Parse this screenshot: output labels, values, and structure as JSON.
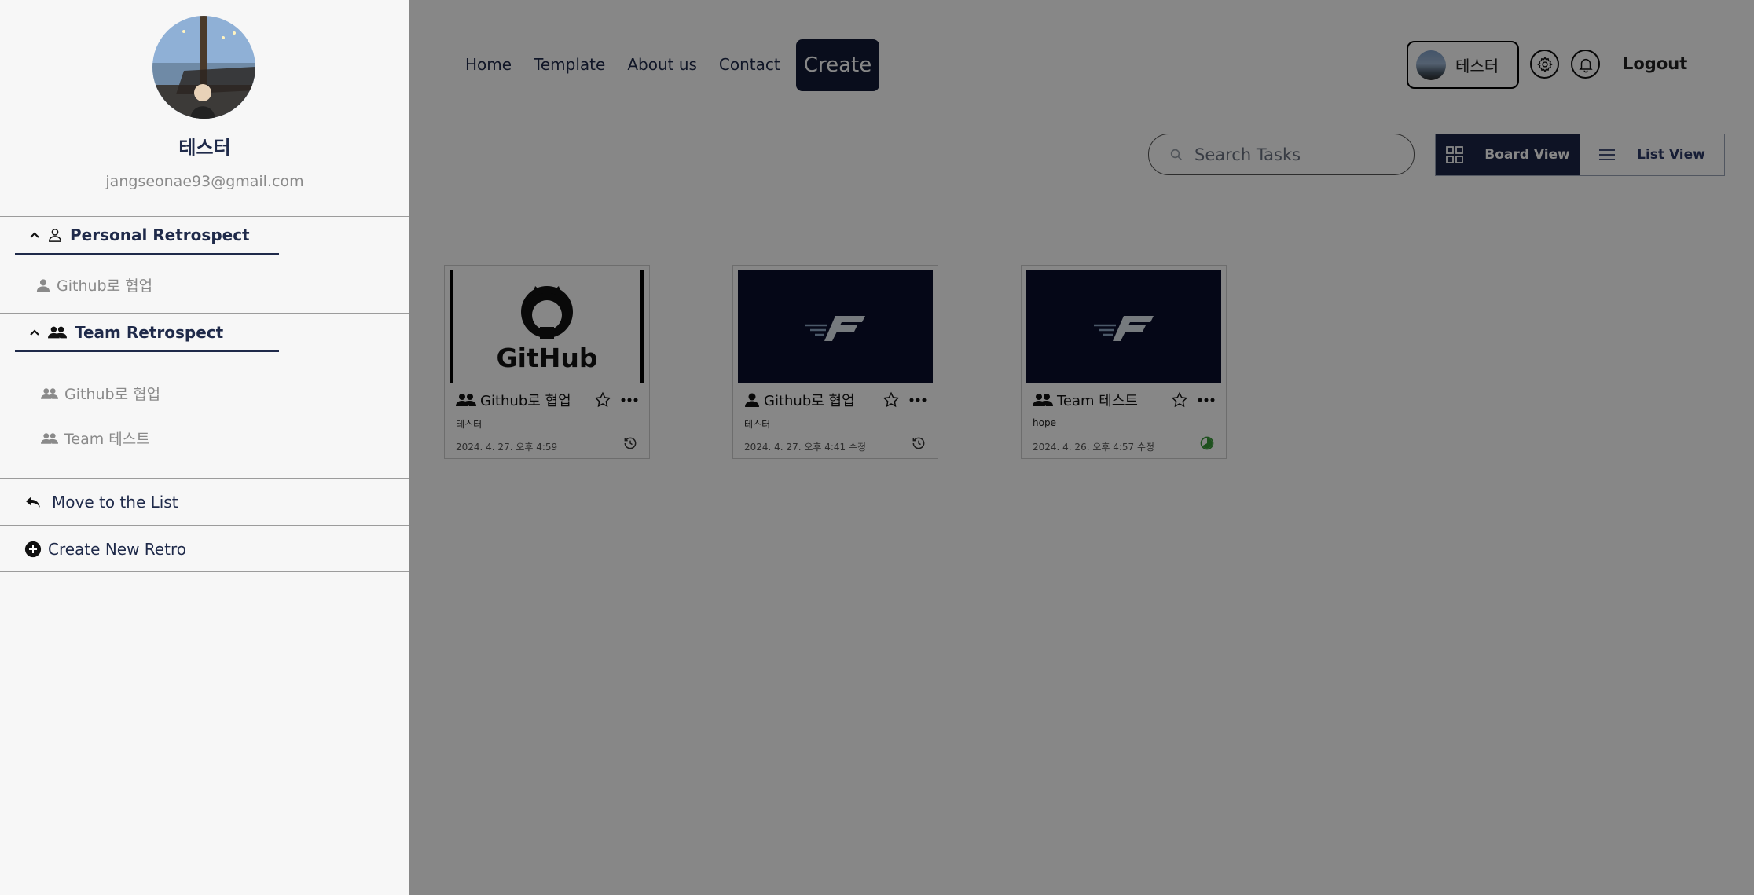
{
  "nav": {
    "links": [
      "Home",
      "Template",
      "About us",
      "Contact"
    ],
    "create_label": "Create",
    "user_name": "테스터",
    "logout_label": "Logout"
  },
  "toolbar": {
    "search_placeholder": "Search Tasks",
    "board_view_label": "Board View",
    "list_view_label": "List View"
  },
  "cards": [
    {
      "thumbnail": "github-logo",
      "type_icon": "team-icon",
      "title": "Github로 협업",
      "subtitle": "테스터",
      "date": "2024. 4. 27. 오후 4:59",
      "status_icon": "history-icon"
    },
    {
      "thumbnail": "brand-logo",
      "type_icon": "person-icon",
      "title": "Github로 협업",
      "subtitle": "테스터",
      "date": "2024. 4. 27. 오후 4:41 수정",
      "status_icon": "history-icon"
    },
    {
      "thumbnail": "brand-logo",
      "type_icon": "team-icon",
      "title": "Team 테스트",
      "subtitle": "hope",
      "date": "2024. 4. 26. 오후 4:57 수정",
      "status_icon": "progress-icon"
    }
  ],
  "card_logo_text": "GitHub",
  "sidebar": {
    "name": "테스터",
    "email": "jangseonae93@gmail.com",
    "personal_title": "Personal Retrospect",
    "personal_items": [
      "Github로 협업"
    ],
    "team_title": "Team Retrospect",
    "team_items": [
      "Github로 협업",
      "Team 테스트"
    ],
    "move_label": "Move to the List",
    "create_label": "Create New Retro"
  },
  "colors": {
    "primary": "#111936",
    "accent_view": "#1c2547",
    "overlay": "rgba(0,0,0,0.47)",
    "status_green": "#3a9a3a"
  }
}
